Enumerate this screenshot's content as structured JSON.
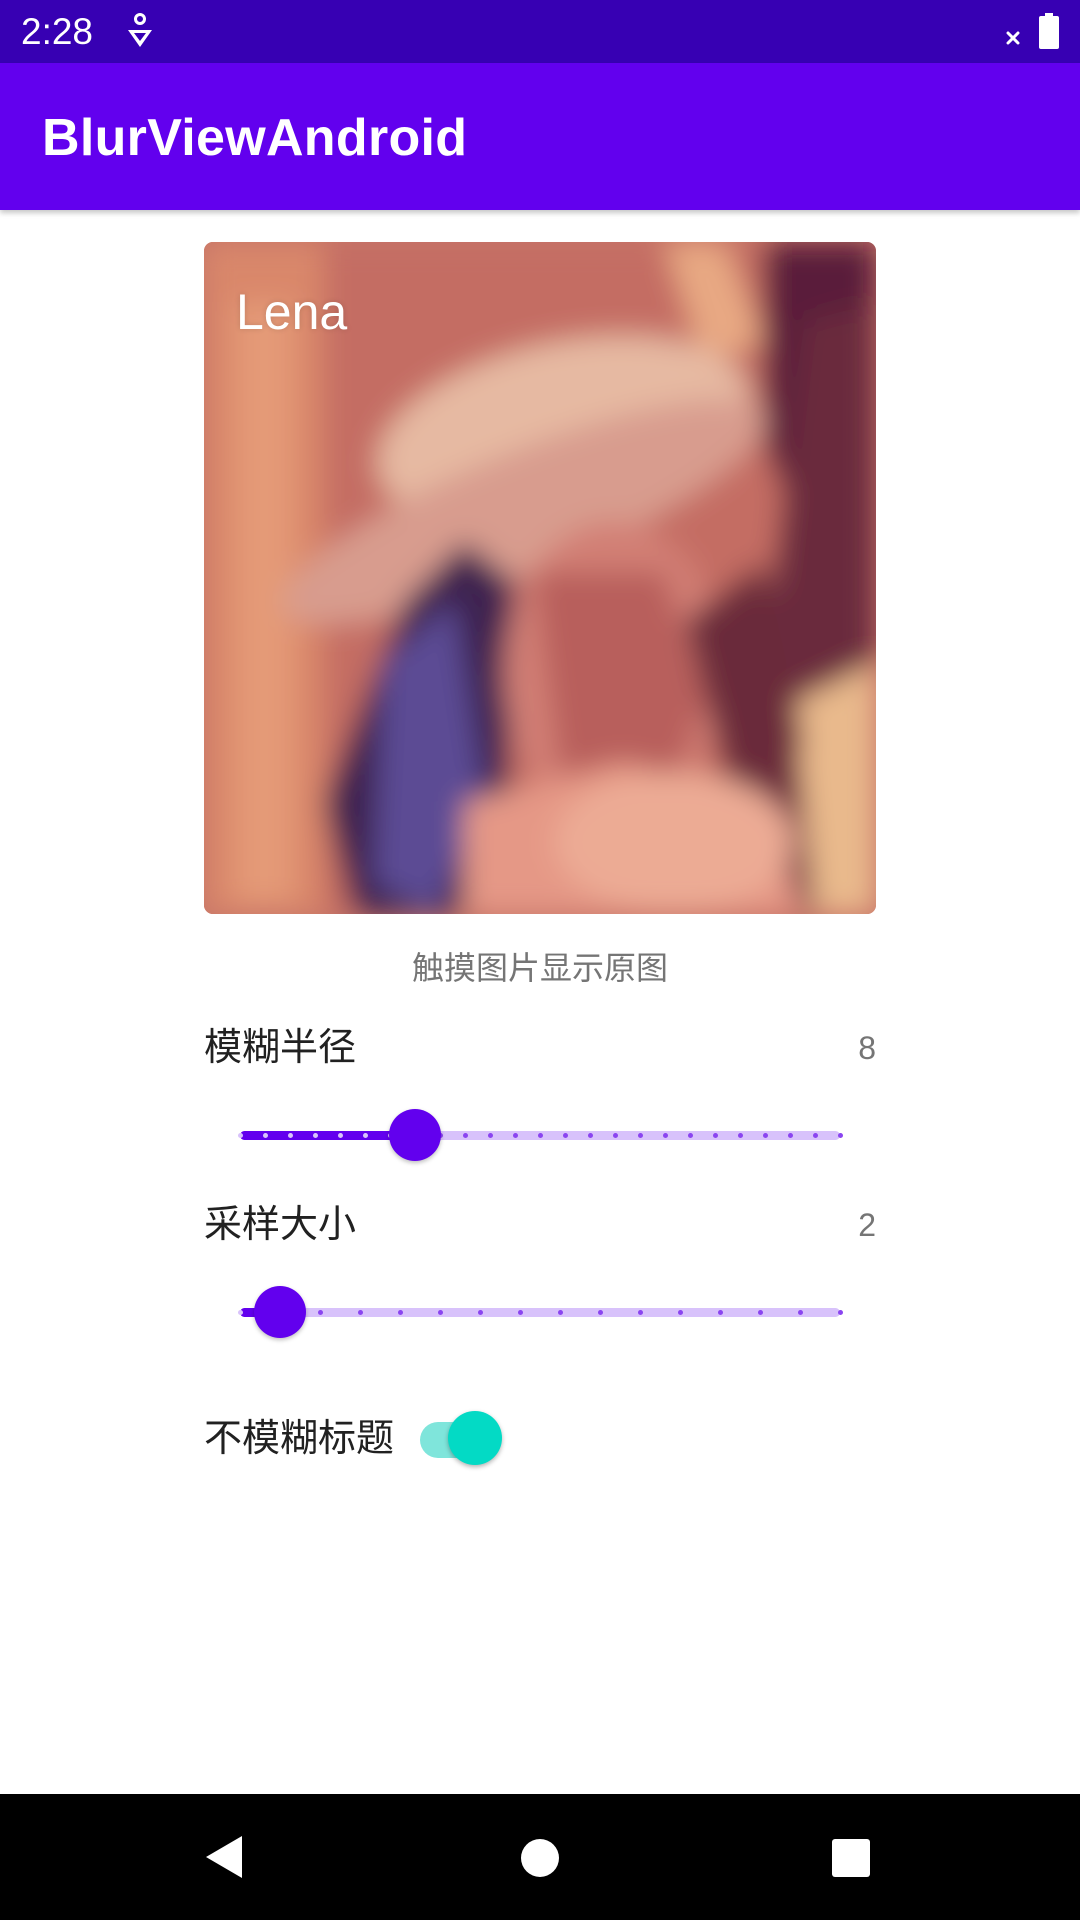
{
  "status_bar": {
    "time": "2:28",
    "icons": [
      "notification-icon",
      "signal-off-icon",
      "battery-icon"
    ]
  },
  "app_bar": {
    "title": "BlurViewAndroid",
    "color": "#6200ee"
  },
  "image_card": {
    "caption": "Lena"
  },
  "hint": {
    "text": "触摸图片显示原图"
  },
  "blur_radius": {
    "label": "模糊半径",
    "value": "8",
    "slider": {
      "min": 1,
      "max": 25,
      "value": 8,
      "step": 1
    }
  },
  "sample_size": {
    "label": "采样大小",
    "value": "2",
    "slider": {
      "min": 1,
      "max": 16,
      "value": 2,
      "step": 1
    }
  },
  "no_blur_title": {
    "label": "不模糊标题",
    "checked": true,
    "accent": "#03dac5"
  },
  "nav_bar": {
    "icons": [
      "back-icon",
      "home-icon",
      "recents-icon"
    ]
  }
}
